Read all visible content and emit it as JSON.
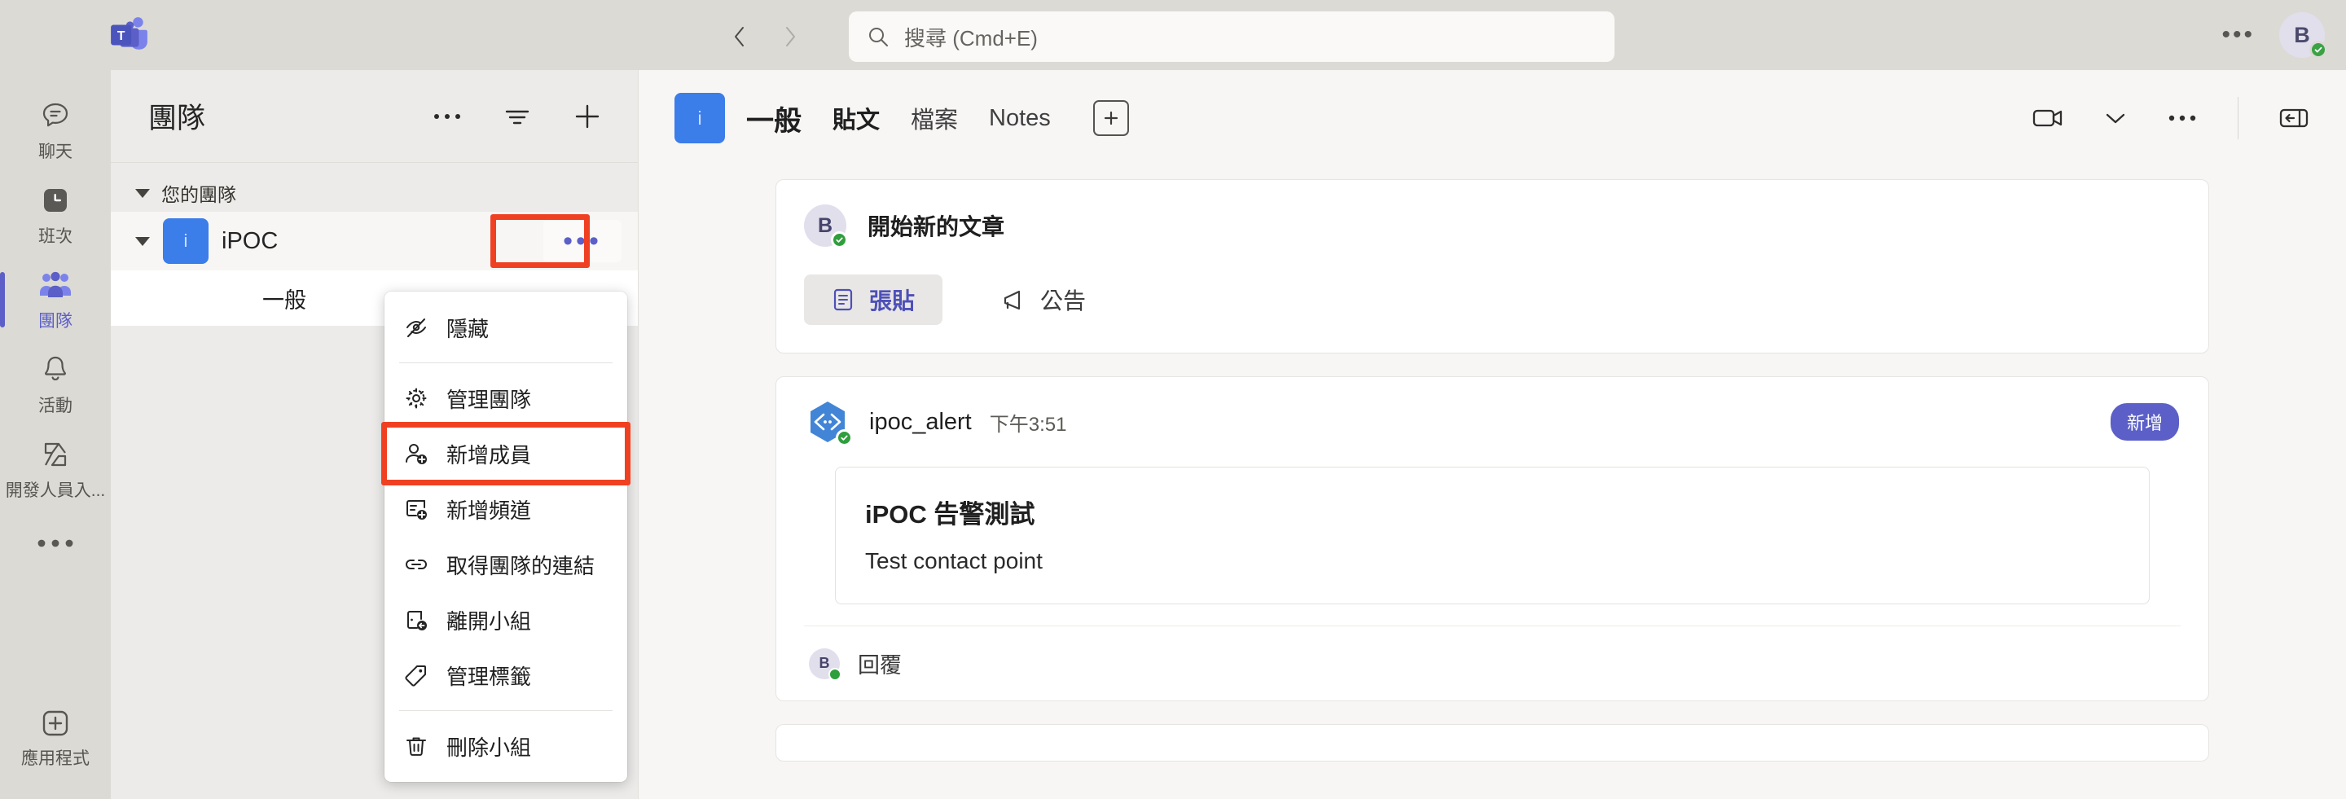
{
  "titlebar": {
    "logo_icon": "teams-logo-icon",
    "back_icon": "chevron-left-icon",
    "forward_icon": "chevron-right-icon",
    "search": {
      "icon": "search-icon",
      "placeholder": "搜尋 (Cmd+E)",
      "value": ""
    },
    "more_label": "•••",
    "avatar": {
      "initial": "B",
      "presence": "available"
    }
  },
  "rail": {
    "items": [
      {
        "label": "聊天",
        "icon": "chat-icon",
        "active": false
      },
      {
        "label": "班次",
        "icon": "shifts-icon",
        "active": false
      },
      {
        "label": "團隊",
        "icon": "teams-icon",
        "active": true
      },
      {
        "label": "活動",
        "icon": "activity-bell-icon",
        "active": false
      },
      {
        "label": "開發人員入...",
        "icon": "developer-portal-icon",
        "active": false
      }
    ],
    "more_label": "•••",
    "apps": {
      "label": "應用程式",
      "icon": "plus-box-icon"
    }
  },
  "teams_panel": {
    "title": "團隊",
    "actions": [
      {
        "name": "more-options",
        "icon": "ellipsis-icon",
        "label": "•••"
      },
      {
        "name": "filter",
        "icon": "filter-icon",
        "label": ""
      },
      {
        "name": "join-or-create-team",
        "icon": "plus-icon",
        "label": ""
      }
    ],
    "group_label": "您的團隊",
    "team": {
      "name": "iPOC",
      "avatar_initial": "i",
      "avatar_color": "#3b7de9",
      "more_label": "•••",
      "highlighted": true
    },
    "channels": [
      {
        "name": "一般",
        "selected": true
      }
    ]
  },
  "context_menu": {
    "items": [
      {
        "label": "隱藏",
        "icon": "eye-off-icon",
        "highlighted": false,
        "separator_after": true
      },
      {
        "label": "管理團隊",
        "icon": "gear-icon",
        "highlighted": false,
        "separator_after": false
      },
      {
        "label": "新增成員",
        "icon": "person-add-icon",
        "highlighted": true,
        "separator_after": false
      },
      {
        "label": "新增頻道",
        "icon": "channel-add-icon",
        "highlighted": false,
        "separator_after": false
      },
      {
        "label": "取得團隊的連結",
        "icon": "link-icon",
        "highlighted": false,
        "separator_after": false
      },
      {
        "label": "離開小組",
        "icon": "leave-icon",
        "highlighted": false,
        "separator_after": false
      },
      {
        "label": "管理標籤",
        "icon": "tag-icon",
        "highlighted": false,
        "separator_after": true
      },
      {
        "label": "刪除小組",
        "icon": "trash-icon",
        "highlighted": false,
        "separator_after": false
      }
    ]
  },
  "channel_header": {
    "avatar_initial": "i",
    "title": "一般",
    "tabs": [
      {
        "label": "貼文",
        "active": true
      },
      {
        "label": "檔案",
        "active": false
      },
      {
        "label": "Notes",
        "active": false
      }
    ],
    "add_tab_label": "+",
    "right_actions": [
      {
        "name": "meet-now",
        "icon": "video-camera-icon"
      },
      {
        "name": "meet-options",
        "icon": "chevron-down-icon"
      },
      {
        "name": "channel-more",
        "icon": "ellipsis-icon",
        "label": "•••"
      },
      {
        "name": "collapse-panel",
        "icon": "panel-collapse-icon"
      }
    ]
  },
  "compose": {
    "avatar_initial": "B",
    "placeholder": "開始新的文章",
    "buttons": [
      {
        "label": "張貼",
        "icon": "post-icon",
        "selected": true
      },
      {
        "label": "公告",
        "icon": "announcement-icon",
        "selected": false
      }
    ]
  },
  "message": {
    "author": "ipoc_alert",
    "time": "下午3:51",
    "badge": "新增",
    "icon": "bot-code-icon",
    "card": {
      "title": "iPOC 告警測試",
      "body": "Test contact point"
    },
    "reply": {
      "avatar_initial": "B",
      "label": "回覆"
    }
  },
  "colors": {
    "accent": "#5b5fc7",
    "team_avatar": "#3b7de9",
    "highlight_box": "#f04022",
    "presence_available": "#2f9e3c",
    "titlebar_bg": "#dcdad5",
    "panel_bg": "#ecebe9",
    "main_bg": "#f7f6f5"
  }
}
